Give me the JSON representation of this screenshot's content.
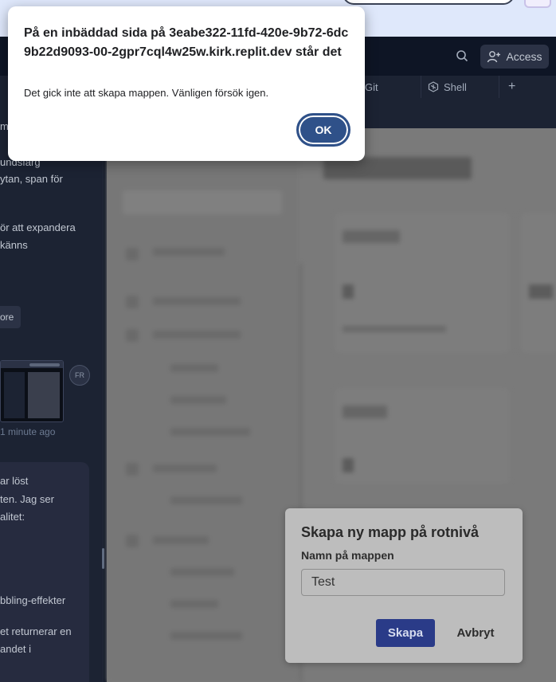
{
  "topbar": {
    "access_label": "Access"
  },
  "tabs": [
    {
      "label": "Git"
    },
    {
      "label": "Shell"
    }
  ],
  "add_tab": "+",
  "chat": {
    "fragments_top": [
      "m",
      "undsfärg",
      "ytan, span för",
      "ör att expandera",
      "känns"
    ],
    "chip_label": "ore",
    "avatar_initials": "FR",
    "time_ago": "1 minute ago",
    "fragments_bubble": [
      "ar löst",
      "ten. Jag ser",
      "alitet:",
      "bbling-effekter",
      "et returnerar en",
      "andet i"
    ]
  },
  "modal": {
    "title": "Skapa ny mapp på rotnivå",
    "label": "Namn på mappen",
    "input_value": "Test",
    "create_label": "Skapa",
    "cancel_label": "Avbryt"
  },
  "alert": {
    "heading": "På en inbäddad sida på 3eabe322-11fd-420e-9b72-6dc9b22d9093-00-2gpr7cql4w25w.kirk.replit.dev står det",
    "message": "Det gick inte att skapa mappen. Vänligen försök igen.",
    "ok_label": "OK"
  },
  "colors": {
    "accent": "#2f5189",
    "create_button": "#2a3b88",
    "ide_bg": "#0e1525"
  }
}
